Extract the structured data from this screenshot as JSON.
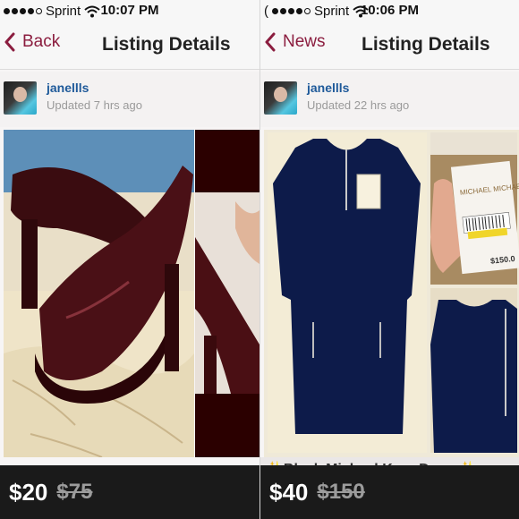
{
  "left": {
    "status": {
      "carrier": "Sprint",
      "time": "10:07 PM"
    },
    "nav": {
      "back_label": "Back",
      "title": "Listing Details"
    },
    "user": {
      "name": "janellls",
      "updated": "Updated 7 hrs ago"
    },
    "price": "$20",
    "original_price": "$75"
  },
  "right": {
    "status": {
      "carrier": "Sprint",
      "time": "10:06 PM"
    },
    "nav": {
      "back_label": "News",
      "title": "Listing Details"
    },
    "user": {
      "name": "janellls",
      "updated": "Updated 22 hrs ago"
    },
    "listing_title": "✨Black Michael Kors Dress✨",
    "tag_text": "MICHAEL MICHAEL KORS",
    "tag_price": "$150.0",
    "price": "$40",
    "original_price": "$150"
  },
  "colors": {
    "accent": "#8b1d3f",
    "username": "#1f5a9a",
    "pricebar": "#1a1a1a"
  }
}
